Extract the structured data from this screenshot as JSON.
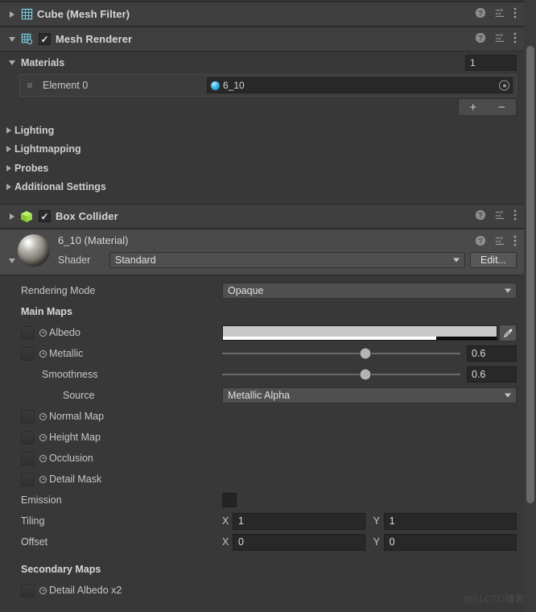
{
  "components": [
    {
      "name": "Cube (Mesh Filter)",
      "icon": "mesh-filter-icon",
      "expanded": false,
      "has_checkbox": false,
      "checked": false
    },
    {
      "name": "Mesh Renderer",
      "icon": "mesh-renderer-icon",
      "expanded": true,
      "has_checkbox": true,
      "checked": true
    },
    {
      "name": "Box Collider",
      "icon": "box-collider-icon",
      "expanded": false,
      "has_checkbox": true,
      "checked": true
    }
  ],
  "header_icons": {
    "help": "help-icon",
    "preset": "preset-icon",
    "menu": "kebab-menu-icon"
  },
  "mesh_renderer": {
    "materials": {
      "label": "Materials",
      "count": "1",
      "elements": [
        {
          "label": "Element 0",
          "value": "6_10"
        }
      ],
      "add_label": "+",
      "remove_label": "−"
    },
    "foldouts": [
      "Lighting",
      "Lightmapping",
      "Probes",
      "Additional Settings"
    ]
  },
  "material": {
    "title": "6_10 (Material)",
    "shader_label": "Shader",
    "shader_value": "Standard",
    "edit_label": "Edit...",
    "rendering_mode_label": "Rendering Mode",
    "rendering_mode_value": "Opaque",
    "main_maps_label": "Main Maps",
    "albedo": {
      "label": "Albedo",
      "color": "#c8c8c8",
      "alpha": 0.78,
      "eyedropper": "eyedropper-icon"
    },
    "metallic": {
      "label": "Metallic",
      "value": "0.6",
      "slider_pct": 60
    },
    "smoothness": {
      "label": "Smoothness",
      "value": "0.6",
      "slider_pct": 60
    },
    "source": {
      "label": "Source",
      "value": "Metallic Alpha"
    },
    "texture_rows": [
      {
        "label": "Normal Map"
      },
      {
        "label": "Height Map"
      },
      {
        "label": "Occlusion"
      },
      {
        "label": "Detail Mask"
      }
    ],
    "emission": {
      "label": "Emission",
      "color": "#242424"
    },
    "tiling": {
      "label": "Tiling",
      "x_label": "X",
      "x_value": "1",
      "y_label": "Y",
      "y_value": "1"
    },
    "offset": {
      "label": "Offset",
      "x_label": "X",
      "x_value": "0",
      "y_label": "Y",
      "y_value": "0"
    },
    "secondary_maps_label": "Secondary Maps",
    "secondary_rows": [
      {
        "label": "Detail Albedo x2"
      }
    ]
  },
  "watermark": "@51CTO博客",
  "colors": {
    "panel_bg": "#383838",
    "header_bg": "#3f3f3f",
    "material_head_bg": "#4a4a4a",
    "field_bg": "#282828",
    "accent_cyan": "#3cb6e8",
    "collider_green": "#9ade3c"
  }
}
